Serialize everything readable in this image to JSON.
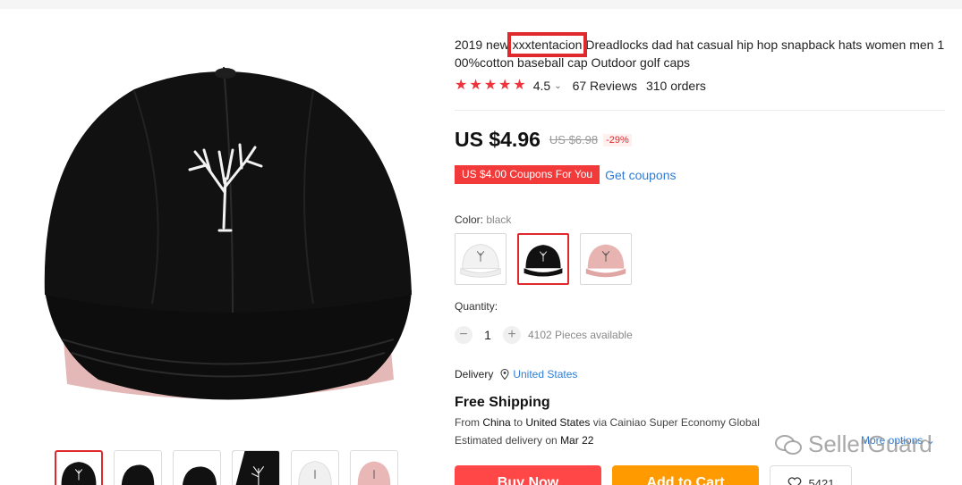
{
  "product": {
    "title_before": "2019 new ",
    "title_highlight": "xxxtentacion",
    "title_after": " Dreadlocks dad hat casual hip hop snapback hats women men 100%cotton baseball cap Outdoor golf caps",
    "rating": "4.5",
    "stars": 5,
    "reviews": "67 Reviews",
    "orders": "310 orders"
  },
  "price": {
    "current": "US $4.96",
    "original": "US $6.98",
    "discount": "-29%"
  },
  "coupon": {
    "badge": "US $4.00 Coupons For You",
    "link": "Get coupons"
  },
  "color": {
    "label": "Color:",
    "selected": "black",
    "options": [
      "white",
      "black",
      "pink"
    ],
    "selected_index": 1
  },
  "quantity": {
    "label": "Quantity:",
    "value": "1",
    "minus": "−",
    "plus": "+",
    "available": "4102 Pieces available"
  },
  "delivery": {
    "label": "Delivery",
    "country": "United States"
  },
  "shipping": {
    "title": "Free Shipping",
    "from_prefix": "From ",
    "from_country": "China",
    "to_word": " to ",
    "to_country": "United States",
    "via_text": " via Cainiao Super Economy Global",
    "est_prefix": "Estimated delivery on ",
    "est_date": "Mar 22",
    "more_options": "More options"
  },
  "actions": {
    "buy_now": "Buy Now",
    "add_to_cart": "Add to Cart",
    "wishlist_count": "5421"
  },
  "thumbnails": [
    "black-front",
    "black-side",
    "black-back",
    "black-closeup",
    "white",
    "pink"
  ],
  "active_thumbnail": 0,
  "watermark": "SellerGuard",
  "colors": {
    "accent_red": "#e0292c",
    "link_blue": "#2e7cd6",
    "buy_red": "#ff4747",
    "cart_orange": "#ff9a00"
  }
}
